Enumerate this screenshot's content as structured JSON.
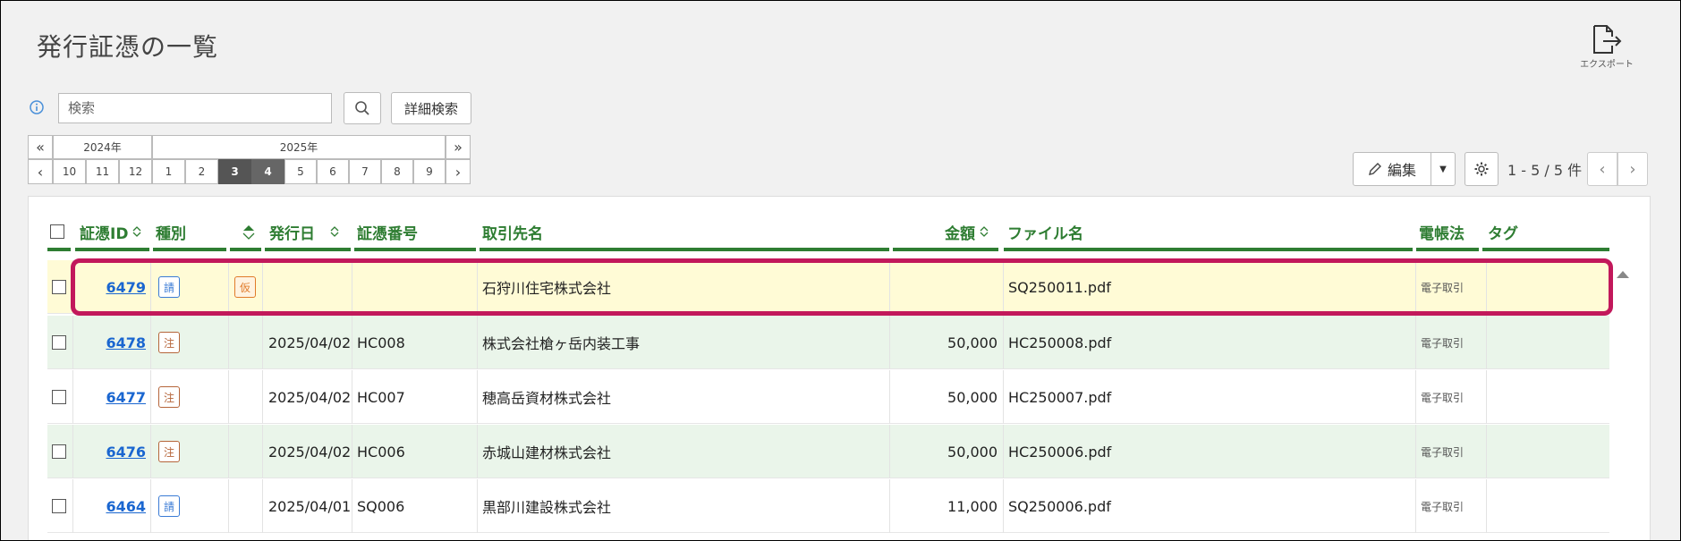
{
  "page": {
    "title": "発行証憑の一覧",
    "export_label": "エクスポート"
  },
  "search": {
    "placeholder": "検索",
    "advanced_label": "詳細検索"
  },
  "calendar": {
    "year_prev": "2024年",
    "year_current": "2025年",
    "months": [
      "10",
      "11",
      "12",
      "1",
      "2",
      "3",
      "4",
      "5",
      "6",
      "7",
      "8",
      "9"
    ],
    "selected_months": [
      "3",
      "4"
    ],
    "fast_prev": "«",
    "fast_next": "»",
    "prev": "‹",
    "next": "›"
  },
  "toolbar": {
    "edit_label": "編集",
    "count_text": "1 - 5 / 5 件"
  },
  "table": {
    "headers": {
      "id": "証憑ID",
      "type": "種別",
      "issue_date": "発行日",
      "doc_no": "証憑番号",
      "client": "取引先名",
      "amount": "金額",
      "file": "ファイル名",
      "ledger": "電帳法",
      "tag": "タグ"
    },
    "rows": [
      {
        "id": "6479",
        "type": "請",
        "status": "仮",
        "date": "",
        "doc": "",
        "client": "石狩川住宅株式会社",
        "amount": "",
        "file": "SQ250011.pdf",
        "ledger": "電子取引",
        "tag": ""
      },
      {
        "id": "6478",
        "type": "注",
        "status": "",
        "date": "2025/04/02",
        "doc": "HC008",
        "client": "株式会社槍ヶ岳内装工事",
        "amount": "50,000",
        "file": "HC250008.pdf",
        "ledger": "電子取引",
        "tag": ""
      },
      {
        "id": "6477",
        "type": "注",
        "status": "",
        "date": "2025/04/02",
        "doc": "HC007",
        "client": "穂高岳資材株式会社",
        "amount": "50,000",
        "file": "HC250007.pdf",
        "ledger": "電子取引",
        "tag": ""
      },
      {
        "id": "6476",
        "type": "注",
        "status": "",
        "date": "2025/04/02",
        "doc": "HC006",
        "client": "赤城山建材株式会社",
        "amount": "50,000",
        "file": "HC250006.pdf",
        "ledger": "電子取引",
        "tag": ""
      },
      {
        "id": "6464",
        "type": "請",
        "status": "",
        "date": "2025/04/01",
        "doc": "SQ006",
        "client": "黒部川建設株式会社",
        "amount": "11,000",
        "file": "SQ250006.pdf",
        "ledger": "電子取引",
        "tag": ""
      }
    ]
  },
  "colors": {
    "header_green": "#2e7d32",
    "link_blue": "#1a66d0",
    "highlight": "#c2185b",
    "row_yellow": "#fffbd6",
    "row_green": "#eaf5ea",
    "badge_quote": "#3a7bd5",
    "badge_order": "#b5653a",
    "badge_provisional": "#e07b2a"
  }
}
